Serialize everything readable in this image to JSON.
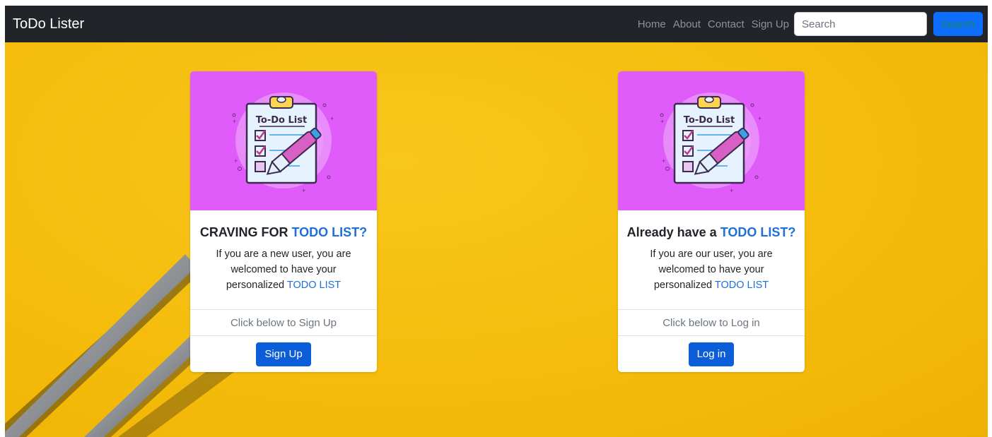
{
  "navbar": {
    "brand": "ToDo Lister",
    "links": [
      "Home",
      "About",
      "Contact",
      "Sign Up"
    ],
    "search_placeholder": "Search",
    "search_button": "Search"
  },
  "cards": [
    {
      "image": {
        "heading": "To-Do List"
      },
      "title_prefix": "CRAVING FOR ",
      "title_accent": "TODO LIST?",
      "text_prefix": "If you are a new user, you are welcomed to have your personalized ",
      "text_accent": "TODO LIST",
      "hint": "Click below to Sign Up",
      "button": "Sign Up"
    },
    {
      "image": {
        "heading": "To-Do List"
      },
      "title_prefix": "Already have a ",
      "title_accent": "TODO LIST?",
      "text_prefix": "If you are our user, you are welcomed to have your personalized ",
      "text_accent": "TODO LIST",
      "hint": "Click below to Log in",
      "button": "Log in"
    }
  ],
  "colors": {
    "navbar": "#212529",
    "hero": "#f6bf0a",
    "card_image_bg": "#df5cfb",
    "accent": "#1f6fd9",
    "button": "#0b5ed7"
  }
}
